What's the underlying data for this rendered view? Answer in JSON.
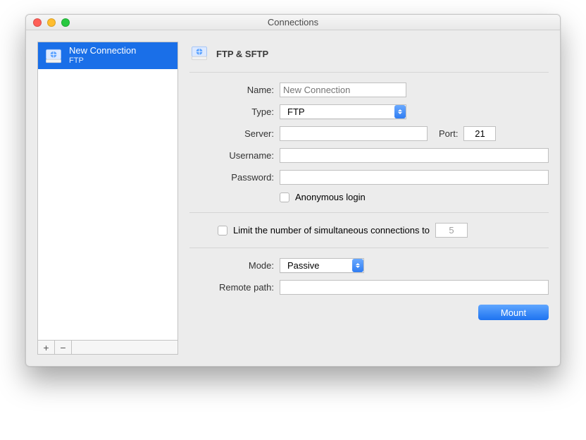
{
  "window": {
    "title": "Connections"
  },
  "sidebar": {
    "items": [
      {
        "title": "New Connection",
        "subtitle": "FTP"
      }
    ],
    "add": "+",
    "remove": "−"
  },
  "panel": {
    "header": "FTP & SFTP",
    "labels": {
      "name": "Name:",
      "type": "Type:",
      "server": "Server:",
      "port": "Port:",
      "username": "Username:",
      "password": "Password:",
      "anonymous": "Anonymous login",
      "limit": "Limit the number of simultaneous connections to",
      "mode": "Mode:",
      "remote_path": "Remote path:"
    },
    "values": {
      "name_placeholder": "New Connection",
      "type": "FTP",
      "server": "",
      "port": "21",
      "username": "",
      "password": "",
      "anonymous_checked": false,
      "limit_checked": false,
      "limit_value": "5",
      "mode": "Passive",
      "remote_path": ""
    },
    "mount_button": "Mount"
  }
}
